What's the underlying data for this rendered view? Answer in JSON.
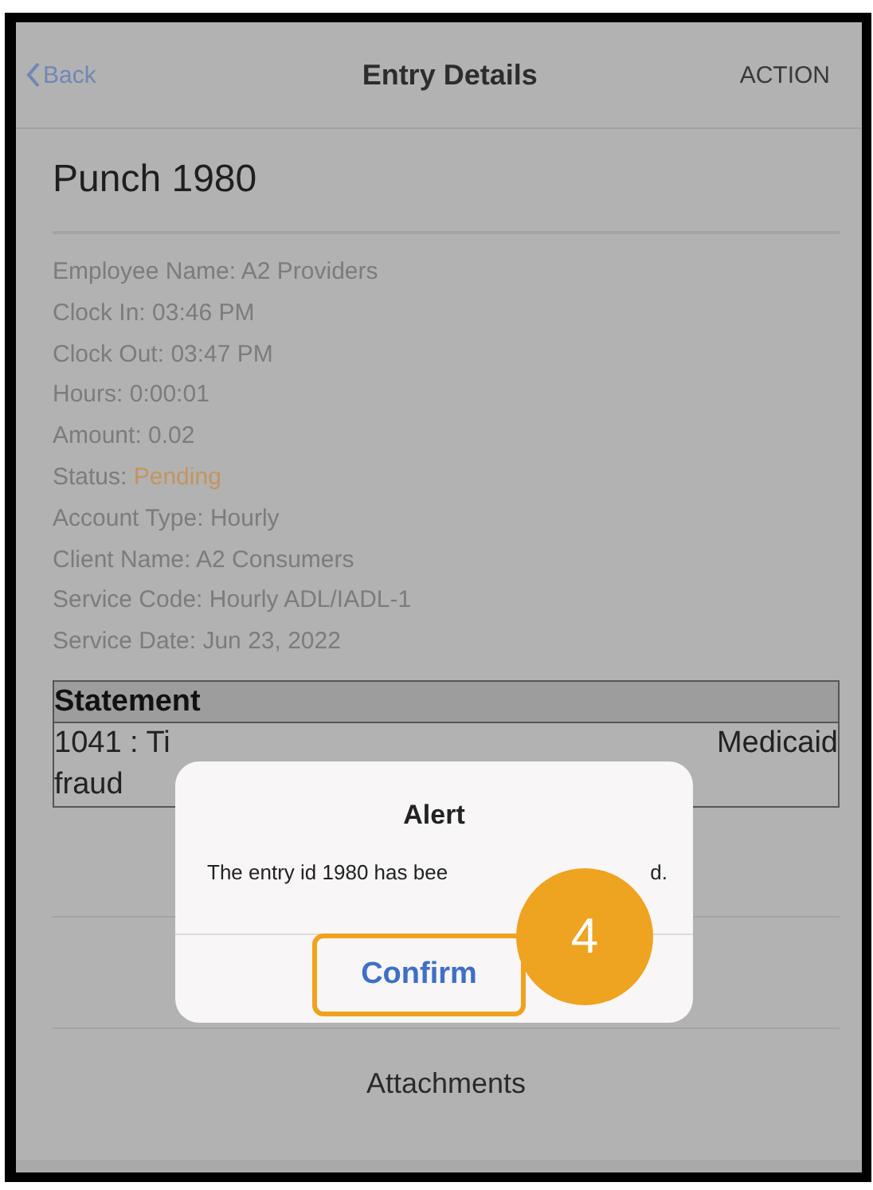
{
  "nav": {
    "back": "Back",
    "title": "Entry Details",
    "action": "ACTION"
  },
  "heading": "Punch 1980",
  "details": [
    {
      "kind": "plain",
      "label": "Employee Name:",
      "value": "A2 Providers"
    },
    {
      "kind": "plain",
      "label": "Clock In:",
      "value": "03:46 PM"
    },
    {
      "kind": "plain",
      "label": "Clock Out:",
      "value": "03:47 PM"
    },
    {
      "kind": "plain",
      "label": "Hours:",
      "value": "0:00:01"
    },
    {
      "kind": "plain",
      "label": "Amount:",
      "value": "0.02"
    },
    {
      "kind": "status",
      "label": "Status:",
      "value": "Pending"
    },
    {
      "kind": "plain",
      "label": "Account Type:",
      "value": "Hourly"
    },
    {
      "kind": "plain",
      "label": "Client Name:",
      "value": "A2 Consumers"
    },
    {
      "kind": "plain",
      "label": "Service Code:",
      "value": "Hourly ADL/IADL-1"
    },
    {
      "kind": "plain",
      "label": "Service Date:",
      "value": "Jun 23, 2022"
    }
  ],
  "statement": {
    "header": "Statement",
    "line_1_start": "1041 : Ti",
    "line_1_end": "Medicaid",
    "line_2": "fraud"
  },
  "attachments": "Attachments",
  "alert": {
    "title": "Alert",
    "message_start": "The entry id 1980 has bee",
    "message_end": "d.",
    "button": "Confirm"
  },
  "callout": {
    "number": "4"
  }
}
